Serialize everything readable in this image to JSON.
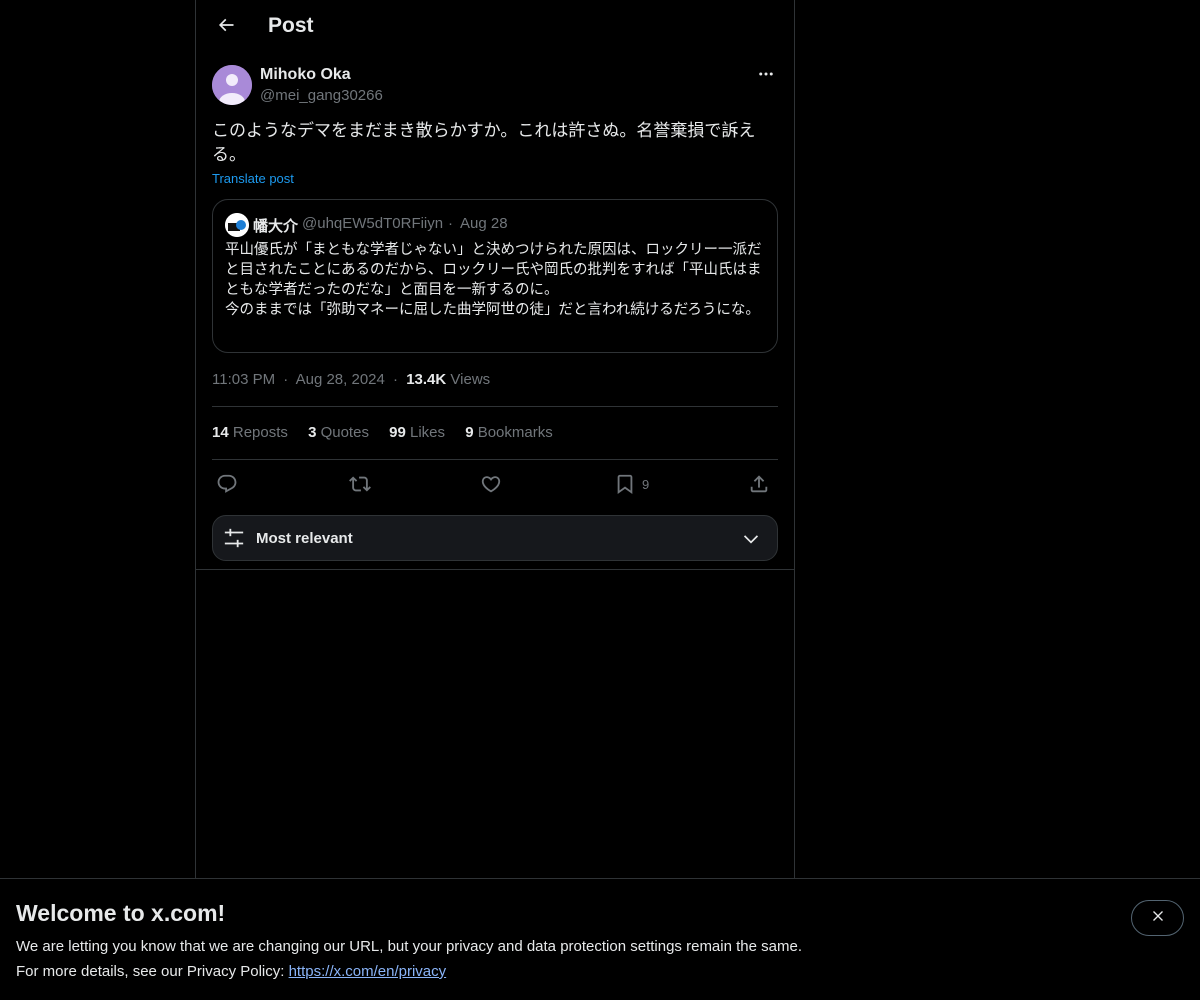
{
  "header": {
    "title": "Post",
    "back_icon": "arrow-left-icon"
  },
  "post": {
    "author_name": "Mihoko Oka",
    "author_handle": "@mei_gang30266",
    "text": "このようなデマをまだまき散らかすか。これは許さぬ。名誉棄損で訴える。",
    "translate_label": "Translate post",
    "time": "11:03 PM",
    "date": "Aug 28, 2024",
    "views_count": "13.4K",
    "views_label": "Views",
    "dot": "·"
  },
  "quote": {
    "author_name": "幡大介",
    "author_handle": "@uhqEW5dT0RFiiyn",
    "dot": "·",
    "date": "Aug 28",
    "text_line1": "平山優氏が「まともな学者じゃない」と決めつけられた原因は、ロックリー一派だと目されたことにあるのだから、ロックリー氏や岡氏の批判をすれば「平山氏はまともな学者だったのだな」と面目を一新するのに。",
    "text_line2": "今のままでは「弥助マネーに屈した曲学阿世の徒」だと言われ続けるだろうにな。"
  },
  "stats": {
    "reposts_count": "14",
    "reposts_label": "Reposts",
    "quotes_count": "3",
    "quotes_label": "Quotes",
    "likes_count": "99",
    "likes_label": "Likes",
    "bookmarks_count": "9",
    "bookmarks_label": "Bookmarks"
  },
  "actions": {
    "reply_icon": "reply-icon",
    "repost_icon": "repost-icon",
    "like_icon": "heart-icon",
    "bookmark_icon": "bookmark-icon",
    "bookmark_count": "9",
    "share_icon": "share-icon"
  },
  "replies_filter": {
    "label": "Most relevant"
  },
  "banner": {
    "title": "Welcome to x.com!",
    "line1": "We are letting you know that we are changing our URL, but your privacy and data protection settings remain the same.",
    "line2_prefix": "For more details, see our Privacy Policy: ",
    "link": "https://x.com/en/privacy"
  },
  "colors": {
    "background": "#000000",
    "text_primary": "#e7e9ea",
    "text_secondary": "#71767b",
    "accent": "#1d9bf0",
    "border": "#2f3336"
  }
}
